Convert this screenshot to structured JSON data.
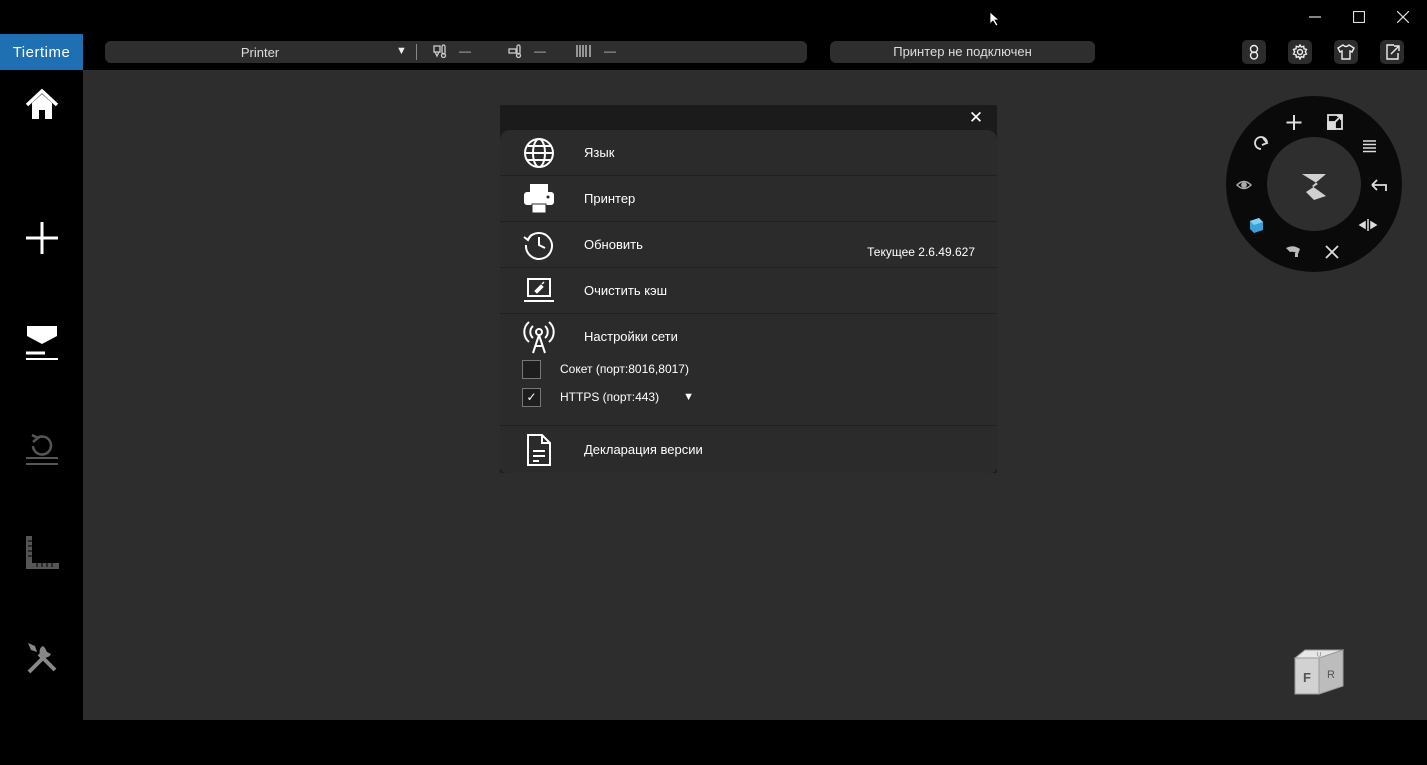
{
  "window": {
    "controls": [
      "minimize",
      "maximize",
      "close"
    ]
  },
  "toolbar": {
    "logo": "Tiertime",
    "printer_name": "Printer",
    "nozzle_temp": "—",
    "bed_temp": "—",
    "material": "—",
    "status": "Принтер не подключен",
    "icons": [
      "account-icon",
      "settings-icon",
      "skin-icon",
      "export-icon"
    ]
  },
  "sidebar": {
    "items": [
      "home",
      "add",
      "print",
      "maintenance",
      "calibrate",
      "tools"
    ]
  },
  "dialog": {
    "close_glyph": "✕",
    "rows": {
      "language": "Язык",
      "printer": "Принтер",
      "update": "Обновить",
      "current_version": "Текущее 2.6.49.627",
      "clear_cache": "Очистить кэш",
      "network": "Настройки сети",
      "version_declaration": "Декларация версии"
    },
    "network_options": {
      "socket_label": "Сокет (порт:8016,8017)",
      "socket_checked": false,
      "https_label": "HTTPS (порт:443)",
      "https_checked": true,
      "check_glyph": "✓",
      "caret_glyph": "▼"
    }
  },
  "radial_menu": {
    "items": [
      "move",
      "scale",
      "layers",
      "undo",
      "mirror",
      "shrink",
      "support",
      "solid",
      "view",
      "rotate"
    ],
    "center": "auto-place"
  },
  "view_cube": {
    "front": "F",
    "right": "R",
    "top": "U"
  }
}
